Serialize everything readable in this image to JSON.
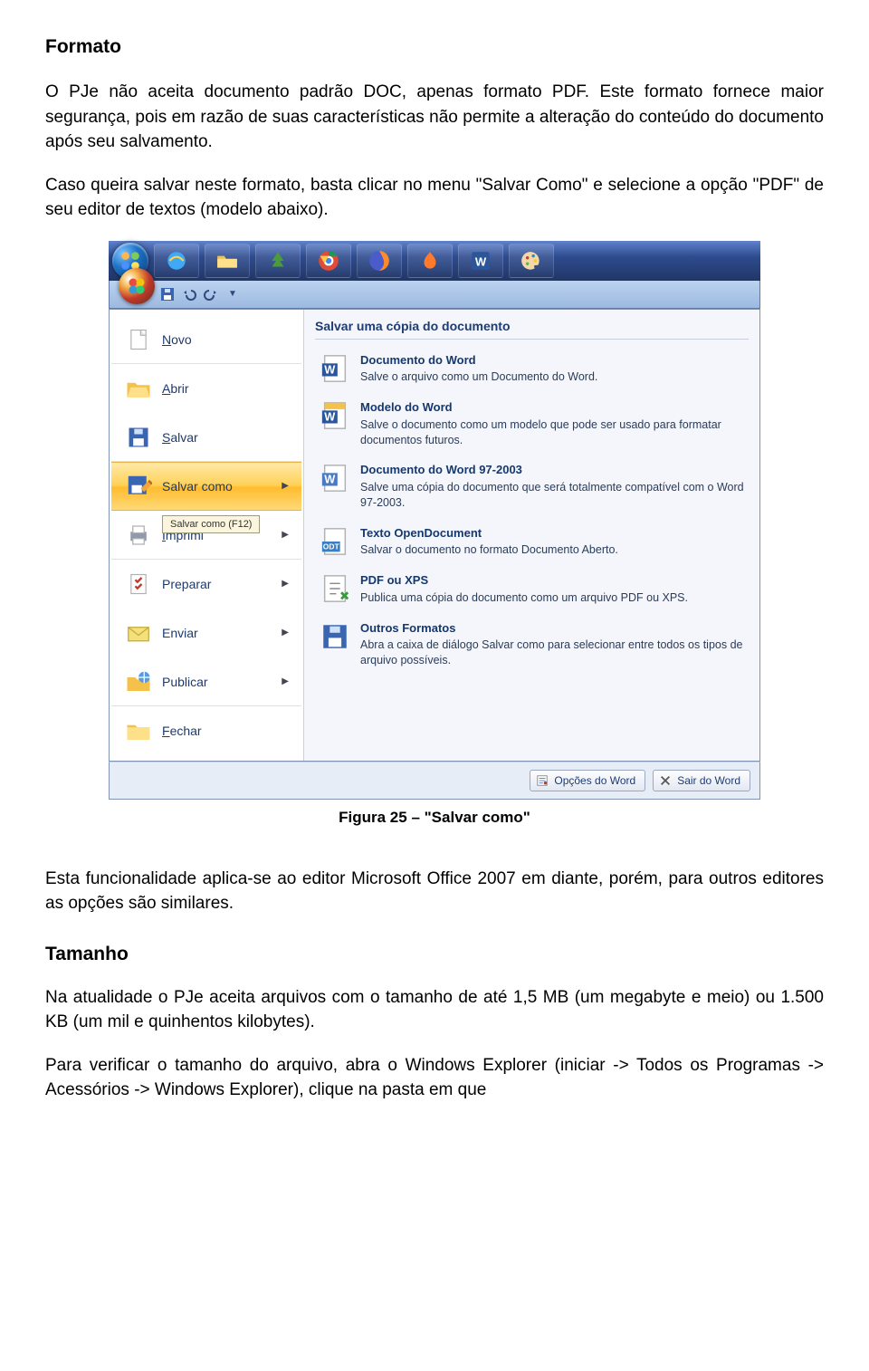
{
  "heading_formato": "Formato",
  "para1": "O PJe não aceita documento padrão DOC, apenas formato PDF. Este formato fornece maior segurança, pois em razão de suas características não permite a alteração do conteúdo do documento após seu salvamento.",
  "para2": "Caso queira salvar neste formato, basta clicar no menu \"Salvar Como\" e selecione a opção \"PDF\" de seu editor de textos (modelo abaixo).",
  "caption": "Figura 25 – \"Salvar como\"",
  "para3": "Esta funcionalidade aplica-se ao editor Microsoft Office 2007 em diante, porém, para outros editores as opções são similares.",
  "heading_tamanho": "Tamanho",
  "para4": "Na atualidade o PJe aceita arquivos com o tamanho de até 1,5 MB (um megabyte e meio) ou 1.500 KB (um mil e quinhentos kilobytes).",
  "para5": "Para verificar o tamanho do arquivo, abra o Windows Explorer (iniciar -> Todos os Programas -> Acessórios -> Windows Explorer), clique na pasta em que",
  "office_menu": {
    "left": [
      {
        "label": "Novo",
        "has_arrow": false
      },
      {
        "label": "Abrir",
        "has_arrow": false
      },
      {
        "label": "Salvar",
        "has_arrow": false
      },
      {
        "label": "Salvar como",
        "has_arrow": true,
        "highlight": true
      },
      {
        "label": "Imprimir",
        "has_arrow": true,
        "tooltip": "Salvar como (F12)"
      },
      {
        "label": "Preparar",
        "has_arrow": true
      },
      {
        "label": "Enviar",
        "has_arrow": true
      },
      {
        "label": "Publicar",
        "has_arrow": true
      },
      {
        "label": "Fechar",
        "has_arrow": false
      }
    ],
    "right_title": "Salvar uma cópia do documento",
    "right": [
      {
        "title": "Documento do Word",
        "desc": "Salve o arquivo como um Documento do Word."
      },
      {
        "title": "Modelo do Word",
        "desc": "Salve o documento como um modelo que pode ser usado para formatar documentos futuros."
      },
      {
        "title": "Documento do Word 97-2003",
        "desc": "Salve uma cópia do documento que será totalmente compatível com o Word 97-2003."
      },
      {
        "title": "Texto OpenDocument",
        "desc": "Salvar o documento no formato Documento Aberto."
      },
      {
        "title": "PDF ou XPS",
        "desc": "Publica uma cópia do documento como um arquivo PDF ou XPS."
      },
      {
        "title": "Outros Formatos",
        "desc": "Abra a caixa de diálogo Salvar como para selecionar entre todos os tipos de arquivo possíveis."
      }
    ],
    "bottom": {
      "options": "Opções do Word",
      "exit": "Sair do Word"
    }
  }
}
